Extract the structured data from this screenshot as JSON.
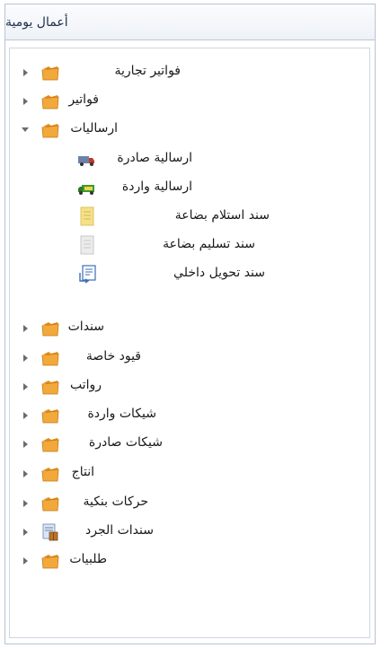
{
  "panel": {
    "title": "أعمال يومية"
  },
  "tree": {
    "items": [
      {
        "label": "فواتير تجارية",
        "icon": "folder-icon",
        "expanded": false
      },
      {
        "label": "فواتير",
        "icon": "folder-icon",
        "expanded": false
      },
      {
        "label": "ارساليات",
        "icon": "folder-icon",
        "expanded": true,
        "children": [
          {
            "label": "ارسالية صادرة",
            "icon": "outgoing-truck-icon"
          },
          {
            "label": "ارسالية واردة",
            "icon": "incoming-truck-icon"
          },
          {
            "label": "سند استلام بضاعة",
            "icon": "receipt-document-icon"
          },
          {
            "label": "سند تسليم بضاعة",
            "icon": "delivery-document-icon"
          },
          {
            "label": "سند تحويل داخلي",
            "icon": "internal-transfer-icon"
          }
        ]
      },
      {
        "label": "سندات",
        "icon": "folder-icon",
        "expanded": false
      },
      {
        "label": "قيود خاصة",
        "icon": "folder-icon",
        "expanded": false
      },
      {
        "label": "رواتب",
        "icon": "folder-icon",
        "expanded": false
      },
      {
        "label": "شيكات واردة",
        "icon": "folder-icon",
        "expanded": false
      },
      {
        "label": "شيكات صادرة",
        "icon": "folder-icon",
        "expanded": false
      },
      {
        "label": "انتاج",
        "icon": "folder-icon",
        "expanded": false
      },
      {
        "label": "حركات بنكية",
        "icon": "folder-icon",
        "expanded": false
      },
      {
        "label": "سندات الجرد",
        "icon": "inventory-icon",
        "expanded": false
      },
      {
        "label": "طلبيات",
        "icon": "folder-icon",
        "expanded": false
      }
    ]
  },
  "colors": {
    "folder": "#f2a93b",
    "header_text": "#1e2d4a",
    "border": "#b9c4d3"
  }
}
